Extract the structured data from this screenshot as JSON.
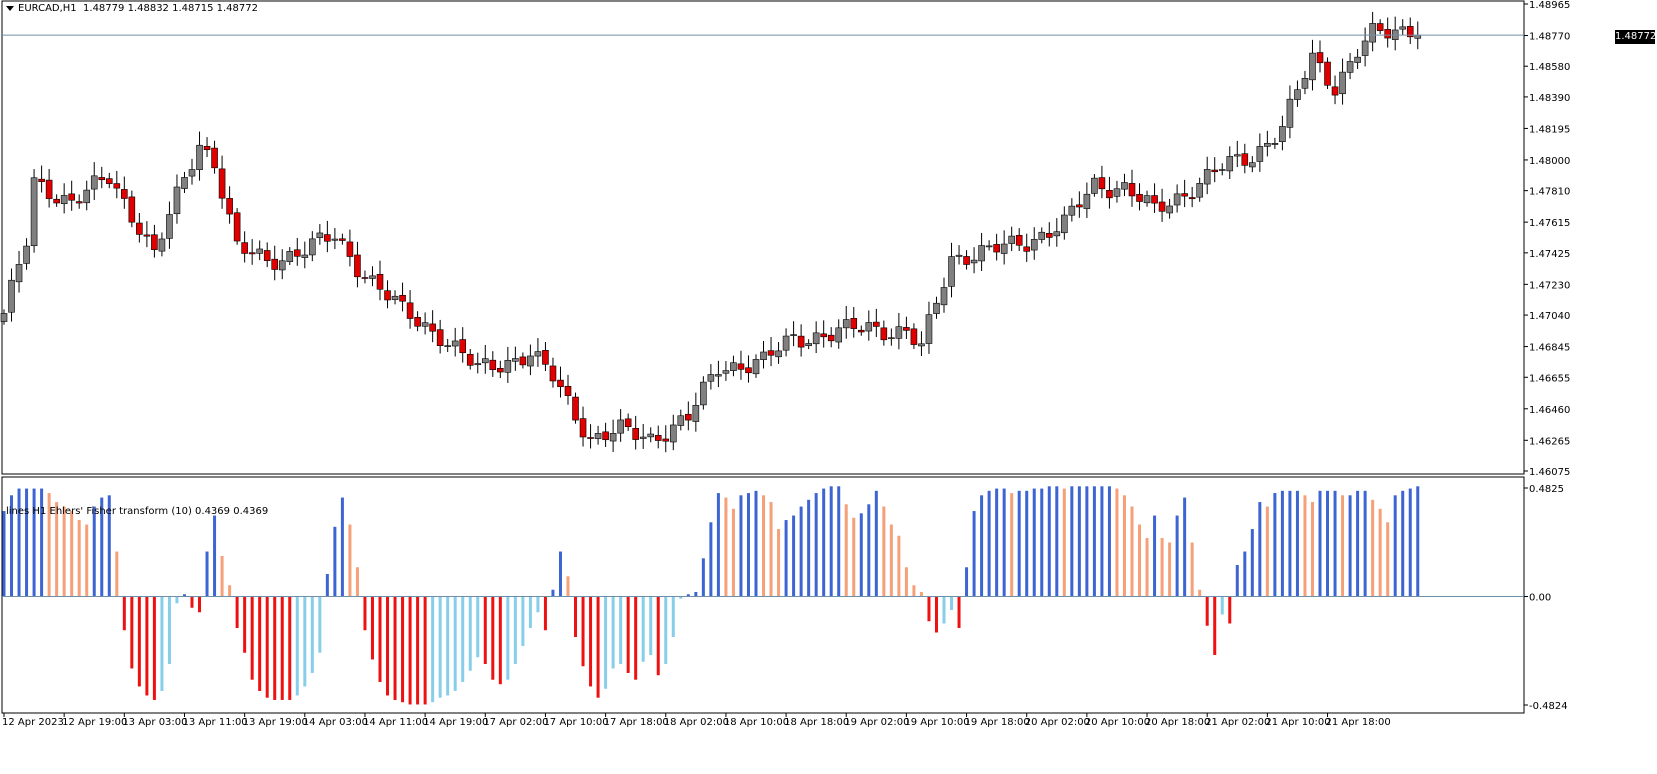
{
  "main_header": {
    "symbol": "EURCAD,H1",
    "ohlc": "1.48779 1.48832 1.48715 1.48772"
  },
  "indicator_header": "lines H1 Ehlers' Fisher transform (10) 0.4369 0.4369",
  "current_price_label": "1.48772",
  "chart_data": [
    {
      "type": "candlestick",
      "title": "EURCAD,H1",
      "y_ticks": [
        "1.48965",
        "1.48770",
        "1.48580",
        "1.48390",
        "1.48195",
        "1.48000",
        "1.47810",
        "1.47615",
        "1.47425",
        "1.47230",
        "1.47040",
        "1.46845",
        "1.46655",
        "1.46460",
        "1.46265",
        "1.46075"
      ],
      "ylim": [
        1.46075,
        1.48965
      ],
      "current_price": 1.48772,
      "x_ticks": [
        "12 Apr 2023",
        "12 Apr 19:00",
        "13 Apr 03:00",
        "13 Apr 11:00",
        "13 Apr 19:00",
        "14 Apr 03:00",
        "14 Apr 11:00",
        "14 Apr 19:00",
        "17 Apr 02:00",
        "17 Apr 10:00",
        "17 Apr 18:00",
        "18 Apr 02:00",
        "18 Apr 10:00",
        "18 Apr 18:00",
        "19 Apr 02:00",
        "19 Apr 10:00",
        "19 Apr 18:00",
        "20 Apr 02:00",
        "20 Apr 10:00",
        "20 Apr 18:00",
        "21 Apr 02:00",
        "21 Apr 10:00",
        "21 Apr 18:00"
      ],
      "colors": {
        "bull": "#808080",
        "bear": "#e00000",
        "outline": "#000000"
      },
      "keypoints": [
        {
          "bar": 0,
          "price": 1.4705
        },
        {
          "bar": 3,
          "price": 1.4748
        },
        {
          "bar": 4,
          "price": 1.4785
        },
        {
          "bar": 9,
          "price": 1.4775
        },
        {
          "bar": 14,
          "price": 1.4788
        },
        {
          "bar": 18,
          "price": 1.476
        },
        {
          "bar": 20,
          "price": 1.4742
        },
        {
          "bar": 26,
          "price": 1.481
        },
        {
          "bar": 28,
          "price": 1.48
        },
        {
          "bar": 31,
          "price": 1.4745
        },
        {
          "bar": 35,
          "price": 1.4737
        },
        {
          "bar": 40,
          "price": 1.4745
        },
        {
          "bar": 44,
          "price": 1.4752
        },
        {
          "bar": 47,
          "price": 1.4735
        },
        {
          "bar": 53,
          "price": 1.4706
        },
        {
          "bar": 58,
          "price": 1.4692
        },
        {
          "bar": 63,
          "price": 1.467
        },
        {
          "bar": 70,
          "price": 1.468
        },
        {
          "bar": 73,
          "price": 1.4665
        },
        {
          "bar": 78,
          "price": 1.4628
        },
        {
          "bar": 82,
          "price": 1.4632
        },
        {
          "bar": 86,
          "price": 1.4628
        },
        {
          "bar": 91,
          "price": 1.464
        },
        {
          "bar": 95,
          "price": 1.4672
        },
        {
          "bar": 101,
          "price": 1.4675
        },
        {
          "bar": 105,
          "price": 1.469
        },
        {
          "bar": 110,
          "price": 1.4692
        },
        {
          "bar": 115,
          "price": 1.4697
        },
        {
          "bar": 120,
          "price": 1.4693
        },
        {
          "bar": 122,
          "price": 1.4683
        },
        {
          "bar": 126,
          "price": 1.474
        },
        {
          "bar": 131,
          "price": 1.4743
        },
        {
          "bar": 136,
          "price": 1.475
        },
        {
          "bar": 141,
          "price": 1.476
        },
        {
          "bar": 145,
          "price": 1.4785
        },
        {
          "bar": 149,
          "price": 1.4783
        },
        {
          "bar": 153,
          "price": 1.4768
        },
        {
          "bar": 158,
          "price": 1.4783
        },
        {
          "bar": 162,
          "price": 1.4795
        },
        {
          "bar": 166,
          "price": 1.4803
        },
        {
          "bar": 170,
          "price": 1.482
        },
        {
          "bar": 174,
          "price": 1.4863
        },
        {
          "bar": 177,
          "price": 1.4846
        },
        {
          "bar": 180,
          "price": 1.4867
        },
        {
          "bar": 182,
          "price": 1.4877
        }
      ]
    },
    {
      "type": "bar",
      "title": "lines H1 Ehlers' Fisher transform (10) 0.4369 0.4369",
      "y_ticks": [
        "0.4825",
        "0.00",
        "-0.4824"
      ],
      "ylim": [
        -0.4824,
        0.4825
      ],
      "colors": {
        "rising_pos": "#3c64d2",
        "falling_pos": "#f5a078",
        "falling_neg": "#ee1111",
        "rising_neg": "#87ceeb"
      },
      "values": [
        0.38,
        0.45,
        0.48,
        0.48,
        0.48,
        0.48,
        0.46,
        0.42,
        0.4,
        0.38,
        0.34,
        0.32,
        0.4,
        0.44,
        0.45,
        0.2,
        -0.15,
        -0.32,
        -0.4,
        -0.44,
        -0.46,
        -0.42,
        -0.3,
        -0.03,
        0.01,
        -0.05,
        -0.07,
        0.2,
        0.36,
        0.18,
        0.05,
        -0.14,
        -0.25,
        -0.37,
        -0.42,
        -0.45,
        -0.46,
        -0.46,
        -0.46,
        -0.44,
        -0.4,
        -0.34,
        -0.25,
        0.1,
        0.31,
        0.44,
        0.32,
        0.13,
        -0.15,
        -0.28,
        -0.38,
        -0.44,
        -0.46,
        -0.47,
        -0.48,
        -0.48,
        -0.48,
        -0.47,
        -0.45,
        -0.44,
        -0.42,
        -0.38,
        -0.33,
        -0.27,
        -0.3,
        -0.37,
        -0.39,
        -0.37,
        -0.3,
        -0.22,
        -0.14,
        -0.07,
        -0.15,
        0.03,
        0.2,
        0.09,
        -0.18,
        -0.31,
        -0.4,
        -0.45,
        -0.41,
        -0.32,
        -0.3,
        -0.34,
        -0.37,
        -0.29,
        -0.26,
        -0.35,
        -0.3,
        -0.18,
        -0.01,
        0.01,
        0.02,
        0.17,
        0.33,
        0.46,
        0.44,
        0.39,
        0.45,
        0.46,
        0.47,
        0.45,
        0.42,
        0.3,
        0.34,
        0.36,
        0.4,
        0.43,
        0.46,
        0.48,
        0.49,
        0.49,
        0.41,
        0.35,
        0.37,
        0.41,
        0.47,
        0.4,
        0.32,
        0.27,
        0.13,
        0.05,
        0.02,
        -0.11,
        -0.16,
        -0.12,
        -0.06,
        -0.14,
        0.13,
        0.38,
        0.45,
        0.47,
        0.48,
        0.48,
        0.46,
        0.47,
        0.47,
        0.48,
        0.48,
        0.49,
        0.49,
        0.48,
        0.49,
        0.49,
        0.49,
        0.49,
        0.49,
        0.49,
        0.48,
        0.45,
        0.4,
        0.32,
        0.26,
        0.36,
        0.26,
        0.24,
        0.36,
        0.44,
        0.24,
        0.03,
        -0.13,
        -0.26,
        -0.08,
        -0.12,
        0.14,
        0.2,
        0.3,
        0.42,
        0.4,
        0.46,
        0.47,
        0.47,
        0.47,
        0.45,
        0.42,
        0.47,
        0.47,
        0.47,
        0.45,
        0.45,
        0.47,
        0.47,
        0.43,
        0.39,
        0.33,
        0.45,
        0.47,
        0.48,
        0.49
      ]
    }
  ]
}
